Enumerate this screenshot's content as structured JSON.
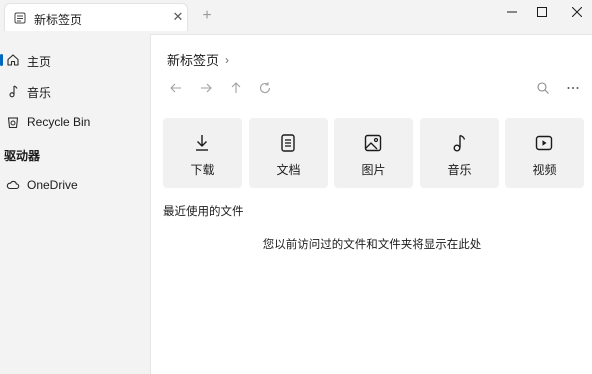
{
  "tab": {
    "title": "新标签页",
    "close": "✕",
    "new": "+"
  },
  "window": {
    "minimize_icon": "minimize-icon",
    "maximize_icon": "maximize-icon",
    "close_icon": "close-icon"
  },
  "sidebar": {
    "items": [
      {
        "label": "主页",
        "icon": "home-icon",
        "selected": true
      },
      {
        "label": "音乐",
        "icon": "music-note-icon"
      },
      {
        "label": "Recycle Bin",
        "icon": "recycle-bin-icon"
      }
    ],
    "section_label": "驱动器",
    "drives": [
      {
        "label": "OneDrive",
        "icon": "cloud-icon"
      }
    ]
  },
  "main": {
    "breadcrumb": {
      "label": "新标签页",
      "chevron": "›"
    },
    "toolbar": [
      "back-arrow-icon",
      "forward-arrow-icon",
      "up-arrow-icon",
      "refresh-icon",
      "search-icon",
      "more-icon"
    ],
    "quick_access": [
      {
        "label": "下载",
        "icon": "download-icon"
      },
      {
        "label": "文档",
        "icon": "document-icon"
      },
      {
        "label": "图片",
        "icon": "picture-icon"
      },
      {
        "label": "音乐",
        "icon": "music-note-icon"
      },
      {
        "label": "视频",
        "icon": "video-icon"
      }
    ],
    "recent_title": "最近使用的文件",
    "empty_message": "您以前访问过的文件和文件夹将显示在此处"
  },
  "colors": {
    "accent": "#0067c0",
    "background": "#f3f3f3",
    "pane": "#ffffff",
    "tile": "#f1f1f1"
  }
}
